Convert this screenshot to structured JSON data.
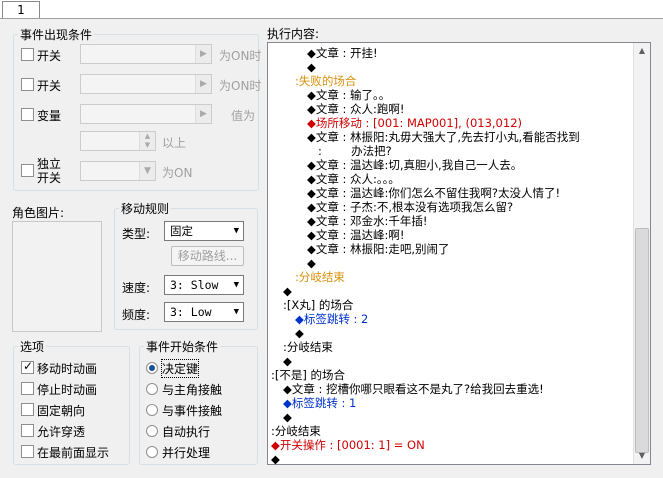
{
  "tab": {
    "label": "1"
  },
  "conditions": {
    "legend": "事件出现条件",
    "switch1": {
      "label": "开关",
      "suffix": "为ON时"
    },
    "switch2": {
      "label": "开关",
      "suffix": "为ON时"
    },
    "variable": {
      "label": "变量",
      "suffix": "值为",
      "above_suffix": "以上"
    },
    "self_switch": {
      "label_line1": "独立",
      "label_line2": "开关",
      "suffix": "为ON"
    }
  },
  "graphic": {
    "label": "角色图片:"
  },
  "movement": {
    "legend": "移动规则",
    "type_label": "类型:",
    "type_value": "固定",
    "route_button": "移动路线...",
    "speed_label": "速度:",
    "speed_value": "3: Slow",
    "freq_label": "频度:",
    "freq_value": "3: Low"
  },
  "options": {
    "legend": "选项",
    "items": [
      {
        "label": "移动时动画",
        "checked": true
      },
      {
        "label": "停止时动画",
        "checked": false
      },
      {
        "label": "固定朝向",
        "checked": false
      },
      {
        "label": "允许穿透",
        "checked": false
      },
      {
        "label": "在最前面显示",
        "checked": false
      }
    ]
  },
  "trigger": {
    "legend": "事件开始条件",
    "items": [
      {
        "label": "决定键",
        "selected": true
      },
      {
        "label": "与主角接触",
        "selected": false
      },
      {
        "label": "与事件接触",
        "selected": false
      },
      {
        "label": "自动执行",
        "selected": false
      },
      {
        "label": "并行处理",
        "selected": false
      }
    ]
  },
  "contents": {
    "label": "执行内容:",
    "lines": [
      {
        "indent": 3,
        "text": "◆文章 : 开挂!",
        "color": "text"
      },
      {
        "indent": 3,
        "text": "◆",
        "color": "text"
      },
      {
        "indent": 2,
        "text": ":失败的场合",
        "color": "orange"
      },
      {
        "indent": 3,
        "text": "◆文章 : 输了。。",
        "color": "text"
      },
      {
        "indent": 3,
        "text": "◆文章 : 众人:跑啊!",
        "color": "text"
      },
      {
        "indent": 3,
        "text": "◆场所移动 : [001: MAP001], (013,012)",
        "color": "red"
      },
      {
        "indent": 3,
        "text": "◆文章 : 林振阳:丸毋大强大了,先去打小丸,看能否找到",
        "color": "text"
      },
      {
        "indent": 3,
        "text": "   :        办法把?",
        "color": "text"
      },
      {
        "indent": 3,
        "text": "◆文章 : 温达峰:切,真胆小,我自己一人去。",
        "color": "text"
      },
      {
        "indent": 3,
        "text": "◆文章 : 众人:。。。",
        "color": "text"
      },
      {
        "indent": 3,
        "text": "◆文章 : 温达峰:你们怎么不留住我啊?太没人情了!",
        "color": "text"
      },
      {
        "indent": 3,
        "text": "◆文章 : 子杰:不,根本没有选项我怎么留?",
        "color": "text"
      },
      {
        "indent": 3,
        "text": "◆文章 : 邓金水:千年插!",
        "color": "text"
      },
      {
        "indent": 3,
        "text": "◆文章 : 温达峰:啊!",
        "color": "text"
      },
      {
        "indent": 3,
        "text": "◆文章 : 林振阳:走吧,别闹了",
        "color": "text"
      },
      {
        "indent": 3,
        "text": "◆",
        "color": "text"
      },
      {
        "indent": 2,
        "text": ":分岐结束",
        "color": "orange"
      },
      {
        "indent": 1,
        "text": "◆",
        "color": "text"
      },
      {
        "indent": 1,
        "text": ":[X丸] 的场合",
        "color": "text"
      },
      {
        "indent": 2,
        "text": "◆标签跳转 : 2",
        "color": "blue"
      },
      {
        "indent": 2,
        "text": "◆",
        "color": "text"
      },
      {
        "indent": 1,
        "text": ":分岐结束",
        "color": "text"
      },
      {
        "indent": 1,
        "text": "◆",
        "color": "text"
      },
      {
        "indent": 0,
        "text": ":[不是] 的场合",
        "color": "text"
      },
      {
        "indent": 1,
        "text": "◆文章 : 挖槽你哪只眼看这不是丸了?给我回去重选!",
        "color": "text"
      },
      {
        "indent": 1,
        "text": "◆标签跳转 : 1",
        "color": "blue"
      },
      {
        "indent": 1,
        "text": "◆",
        "color": "text"
      },
      {
        "indent": 0,
        "text": ":分岐结束",
        "color": "text"
      },
      {
        "indent": 0,
        "text": "◆开关操作 : [0001: 1] = ON",
        "color": "red"
      },
      {
        "indent": 0,
        "text": "◆",
        "color": "text"
      }
    ]
  },
  "colors": {
    "text": "#000000",
    "orange": "#d9900c",
    "red": "#d00000",
    "blue": "#0033cc"
  }
}
